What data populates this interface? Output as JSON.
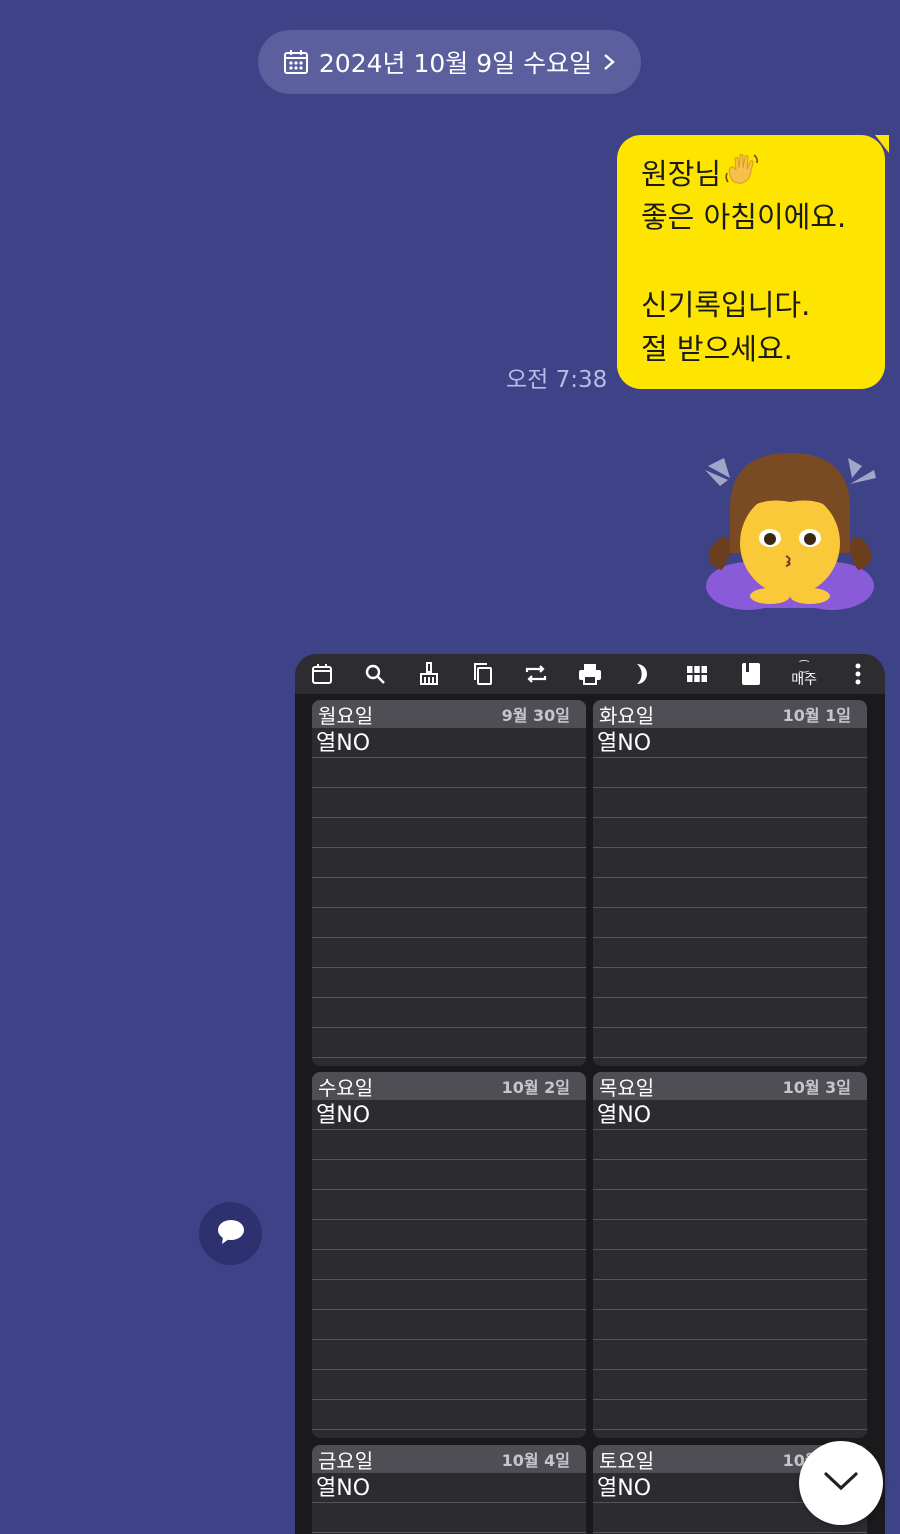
{
  "date_divider": {
    "label": "2024년 10월 9일 수요일",
    "icon": "calendar-icon",
    "chevron": "chevron-right-icon"
  },
  "message": {
    "lines": [
      "원장님",
      "좋은 아침이에요.",
      "",
      "신기록입니다.",
      "절 받으세요."
    ],
    "emoji": "waving-hand-icon",
    "time": "오전 7:38",
    "bubble_color": "#fee500"
  },
  "sticker": {
    "icon": "bowing-girl-emoji-icon"
  },
  "image_card": {
    "toolbar": {
      "icons": [
        "calendar-icon",
        "search-icon",
        "broom-icon",
        "copy-icon",
        "repeat-icon",
        "print-icon",
        "moon-icon",
        "grid-icon",
        "book-icon"
      ],
      "weekly_label": "매주",
      "more": "more-vertical-icon"
    },
    "days": [
      {
        "name": "월요일",
        "date": "9월 30일",
        "entry": "열NO"
      },
      {
        "name": "화요일",
        "date": "10월 1일",
        "entry": "열NO"
      },
      {
        "name": "수요일",
        "date": "10월 2일",
        "entry": "열NO"
      },
      {
        "name": "목요일",
        "date": "10월 3일",
        "entry": "열NO"
      },
      {
        "name": "금요일",
        "date": "10월 4일",
        "entry": "열NO"
      },
      {
        "name": "토요일",
        "date": "10월 5일",
        "entry": "열NO"
      }
    ]
  },
  "buttons": {
    "chat": "chat-bubble-icon",
    "scroll_down": "chevron-down-icon"
  },
  "colors": {
    "background": "#3e4287",
    "pill": "#5b5f9e",
    "card": "#1a1a1d"
  }
}
